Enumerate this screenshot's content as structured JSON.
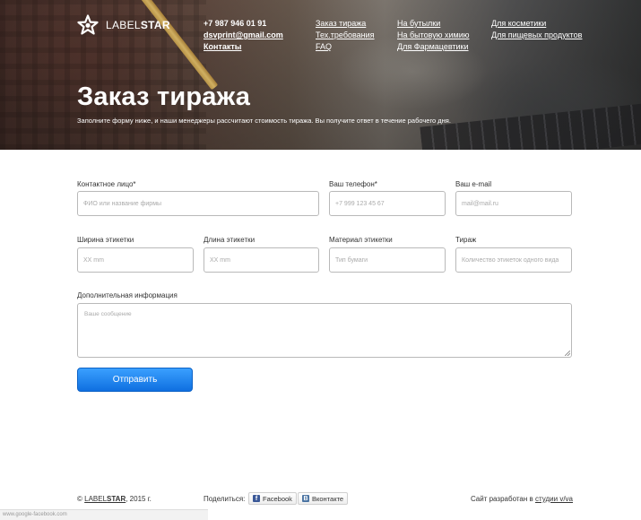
{
  "header": {
    "logo_text_light": "LABEL",
    "logo_text_bold": "STAR",
    "phone": "+7 987 946 01 91",
    "email": "dsvprint@gmail.com",
    "contacts_link": "Контакты",
    "nav": [
      [
        "Заказ тиража",
        "Тех.требования",
        "FAQ"
      ],
      [
        "На бутылки",
        "На бытовую химию",
        "Для Фармацевтики"
      ],
      [
        "Для косметики",
        "Для пищевых продуктов"
      ]
    ],
    "title": "Заказ тиража",
    "subtitle": "Заполните форму ниже, и наши менеджеры рассчитают стоимость тиража. Вы получите ответ в течение рабочего дня."
  },
  "form": {
    "contact_label": "Контактное лицо*",
    "contact_placeholder": "ФИО или название фирмы",
    "phone_label": "Ваш телефон*",
    "phone_placeholder": "+7 999 123 45 67",
    "email_label": "Ваш e-mail",
    "email_placeholder": "mail@mail.ru",
    "width_label": "Ширина этикетки",
    "width_placeholder": "XX mm",
    "length_label": "Длина этикетки",
    "length_placeholder": "XX mm",
    "material_label": "Материал этикетки",
    "material_placeholder": "Тип бумаги",
    "run_label": "Тираж",
    "run_placeholder": "Количество этикеток одного вида",
    "info_label": "Дополнительная информация",
    "info_placeholder": "Ваше сообщение",
    "submit": "Отправить"
  },
  "footer": {
    "copyright_prefix": "©",
    "brand_light": "LABEL",
    "brand_bold": "STAR",
    "copyright_suffix": ", 2015 г.",
    "share_label": "Поделиться:",
    "facebook": "Facebook",
    "vkontakte": "Вконтакте",
    "developer_prefix": "Сайт разработан в",
    "developer_link": "студии v/va",
    "status_text": "www.google-facebook.com"
  },
  "colors": {
    "accent": "#1a7ff0",
    "facebook": "#3b5998",
    "vkontakte": "#4c75a3"
  }
}
